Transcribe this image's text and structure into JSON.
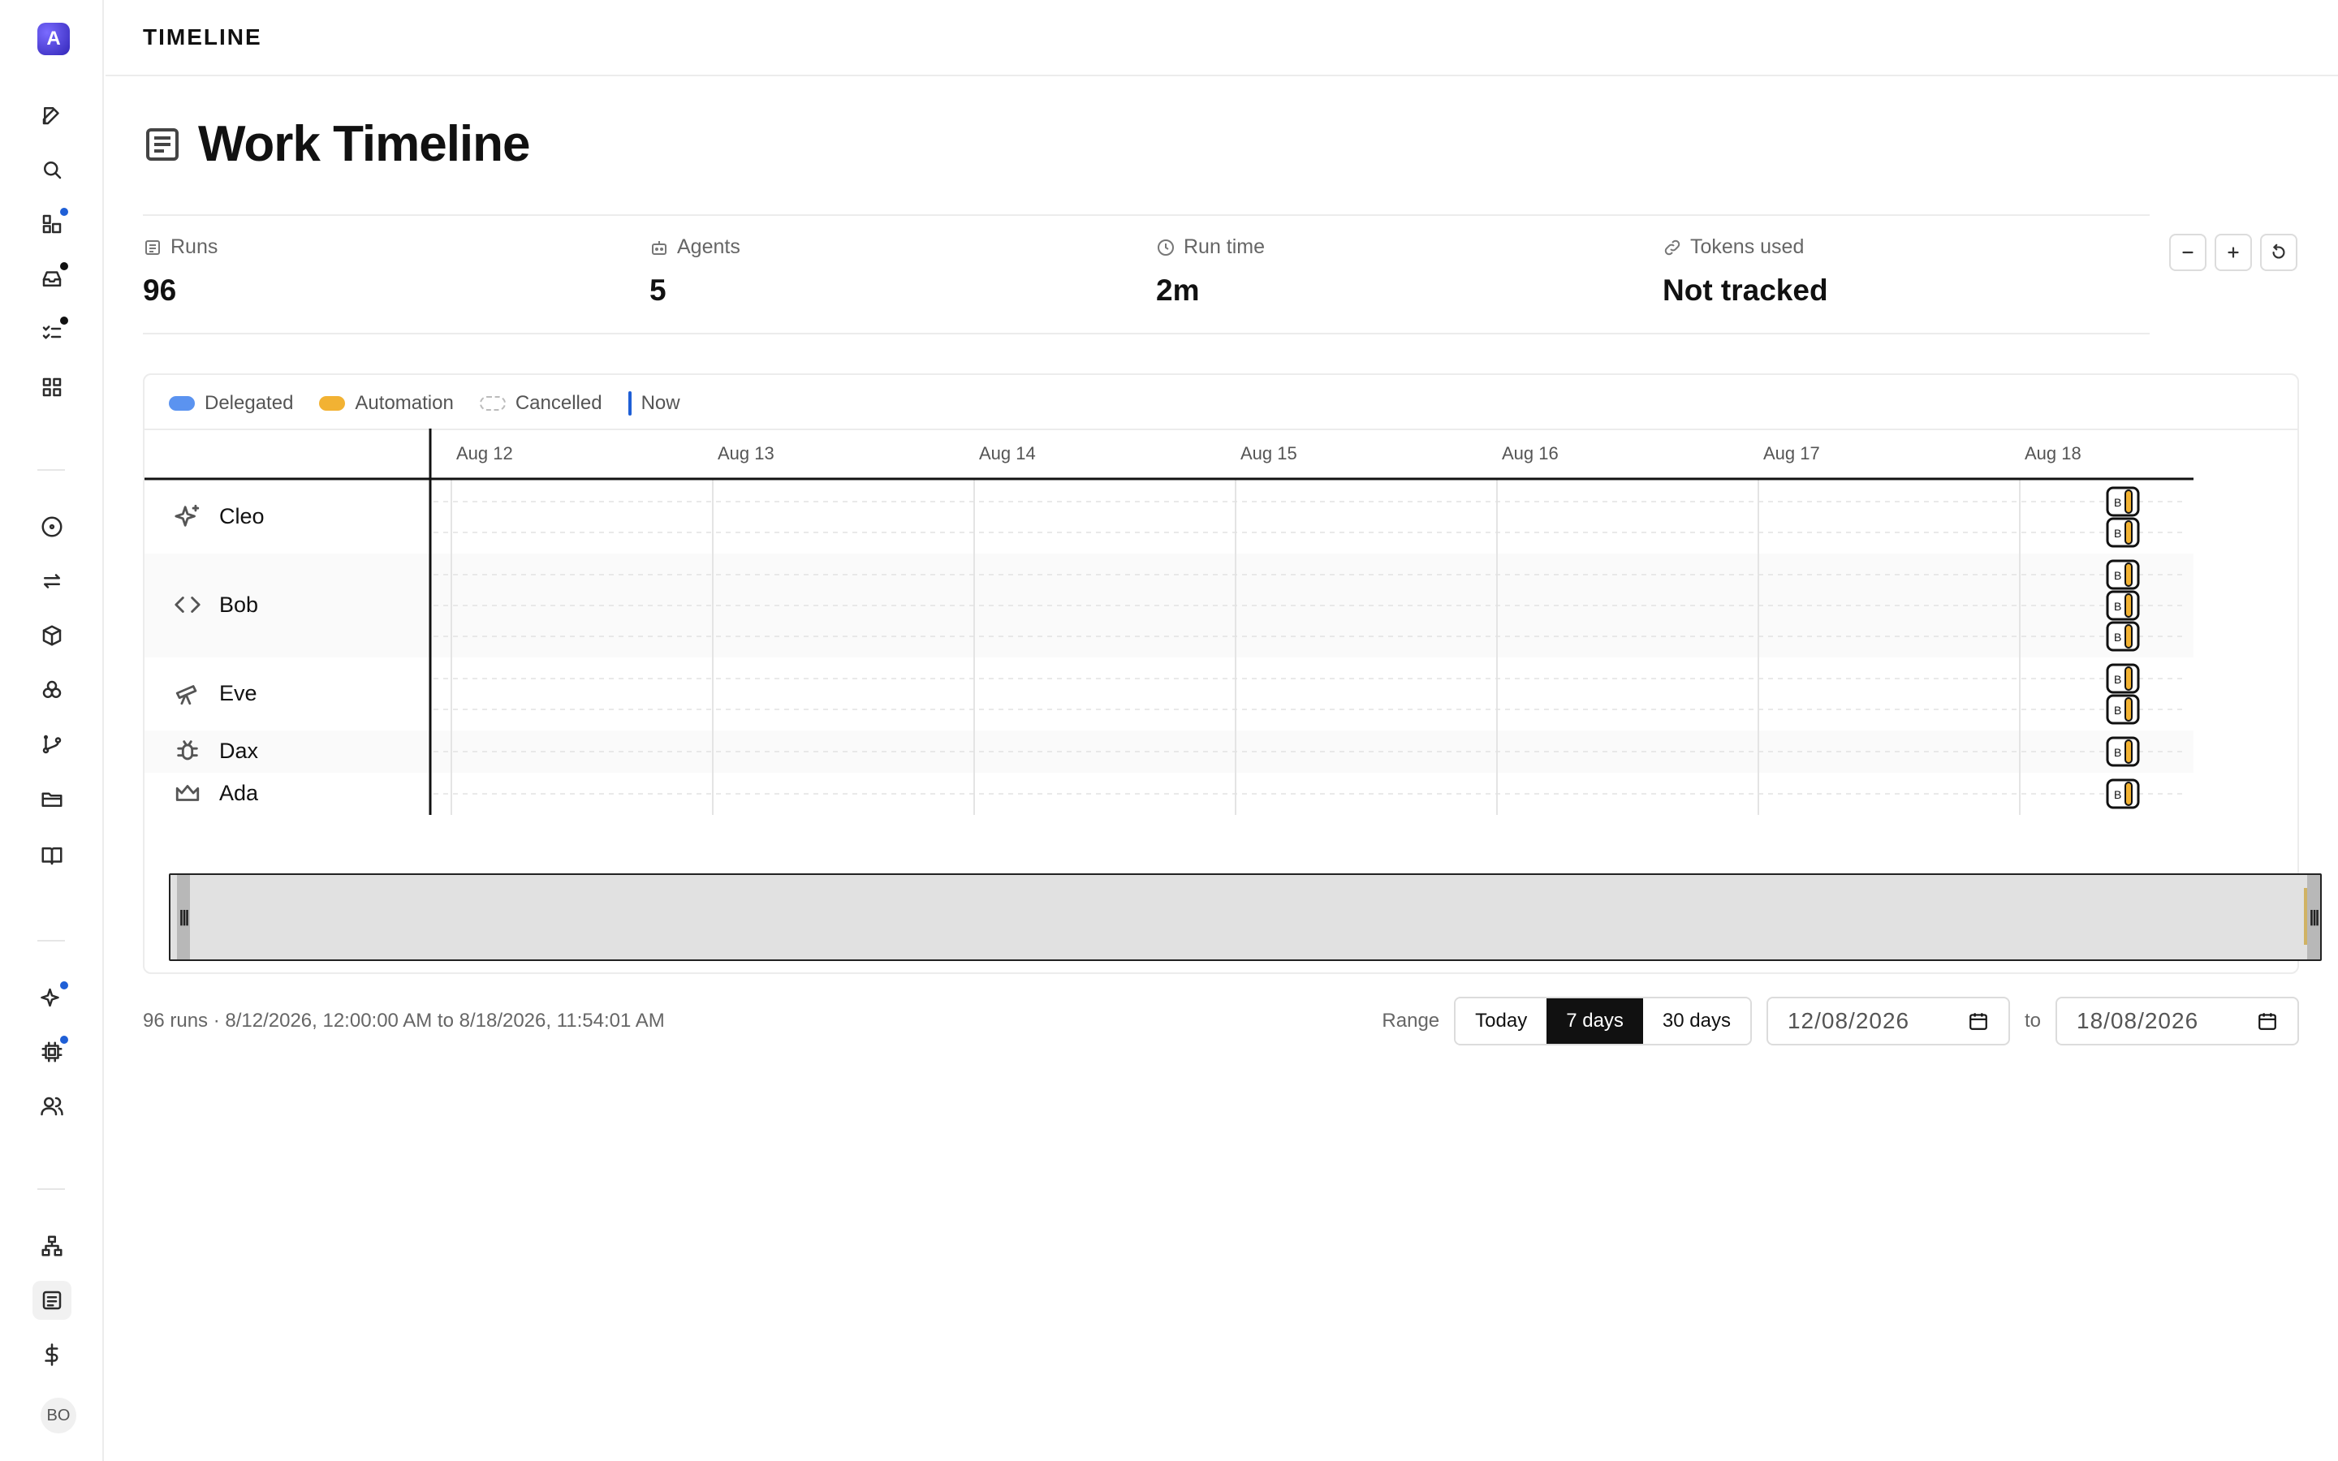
{
  "app": {
    "logo_letter": "A",
    "user_initials": "BO"
  },
  "topbar": {
    "title": "TIMELINE"
  },
  "page": {
    "title": "Work Timeline"
  },
  "stats": [
    {
      "label": "Runs",
      "value": "96",
      "icon": "list-icon"
    },
    {
      "label": "Agents",
      "value": "5",
      "icon": "robot-icon"
    },
    {
      "label": "Run time",
      "value": "2m",
      "icon": "clock-icon"
    },
    {
      "label": "Tokens used",
      "value": "Not tracked",
      "icon": "link-icon"
    }
  ],
  "legend": {
    "delegated": "Delegated",
    "automation": "Automation",
    "cancelled": "Cancelled",
    "now": "Now"
  },
  "colors": {
    "delegated": "#5b93f0",
    "automation": "#f2b233",
    "now": "#1f5fd6",
    "notification_blue": "#1f5fd6",
    "notification_black": "#111111"
  },
  "timeline": {
    "days": [
      "Aug 12",
      "Aug 13",
      "Aug 14",
      "Aug 15",
      "Aug 16",
      "Aug 17",
      "Aug 18"
    ],
    "agents": [
      {
        "name": "Cleo",
        "icon": "sparkle-icon",
        "lanes": 2,
        "runs": 2,
        "shaded": false
      },
      {
        "name": "Bob",
        "icon": "code-icon",
        "lanes": 3,
        "runs": 3,
        "shaded": true
      },
      {
        "name": "Eve",
        "icon": "telescope-icon",
        "lanes": 2,
        "runs": 2,
        "shaded": false
      },
      {
        "name": "Dax",
        "icon": "bug-icon",
        "lanes": 1,
        "runs": 1,
        "shaded": true
      },
      {
        "name": "Ada",
        "icon": "crown-icon",
        "lanes": 1,
        "runs": 1,
        "shaded": false
      }
    ],
    "run_label": "B"
  },
  "footer": {
    "summary": "96 runs · 8/12/2026, 12:00:00 AM to 8/18/2026, 11:54:01 AM",
    "range_label": "Range",
    "range_options": [
      "Today",
      "7 days",
      "30 days"
    ],
    "range_selected": "7 days",
    "to_label": "to",
    "date_from": "12/08/2026",
    "date_to": "18/08/2026"
  }
}
